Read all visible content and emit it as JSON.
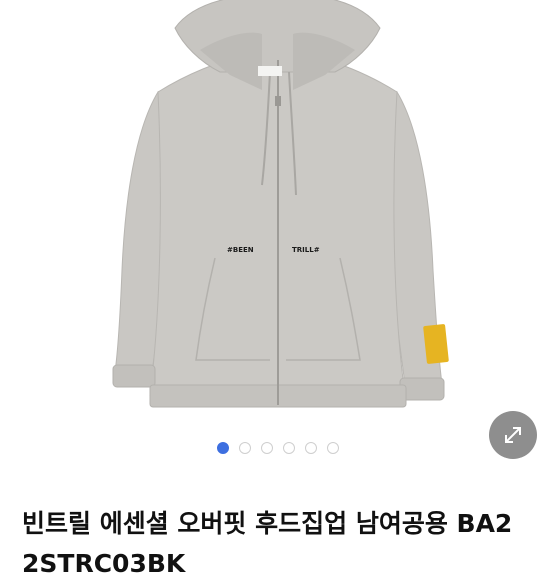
{
  "product": {
    "title_line1": "빈트릴 에센셜 오버핏 후드집업 남여공용 BA2",
    "title_line2": "2STRC03BK",
    "print_left": "#BEEN",
    "print_right": "TRILL#"
  },
  "gallery": {
    "image_count": 6,
    "active_index": 0
  },
  "icons": {
    "zoom": "expand-arrows-icon"
  },
  "colors": {
    "hoodie": "#c8c6c2",
    "active_dot": "#3d6fe0",
    "zoom_button": "#8e8e8e"
  }
}
